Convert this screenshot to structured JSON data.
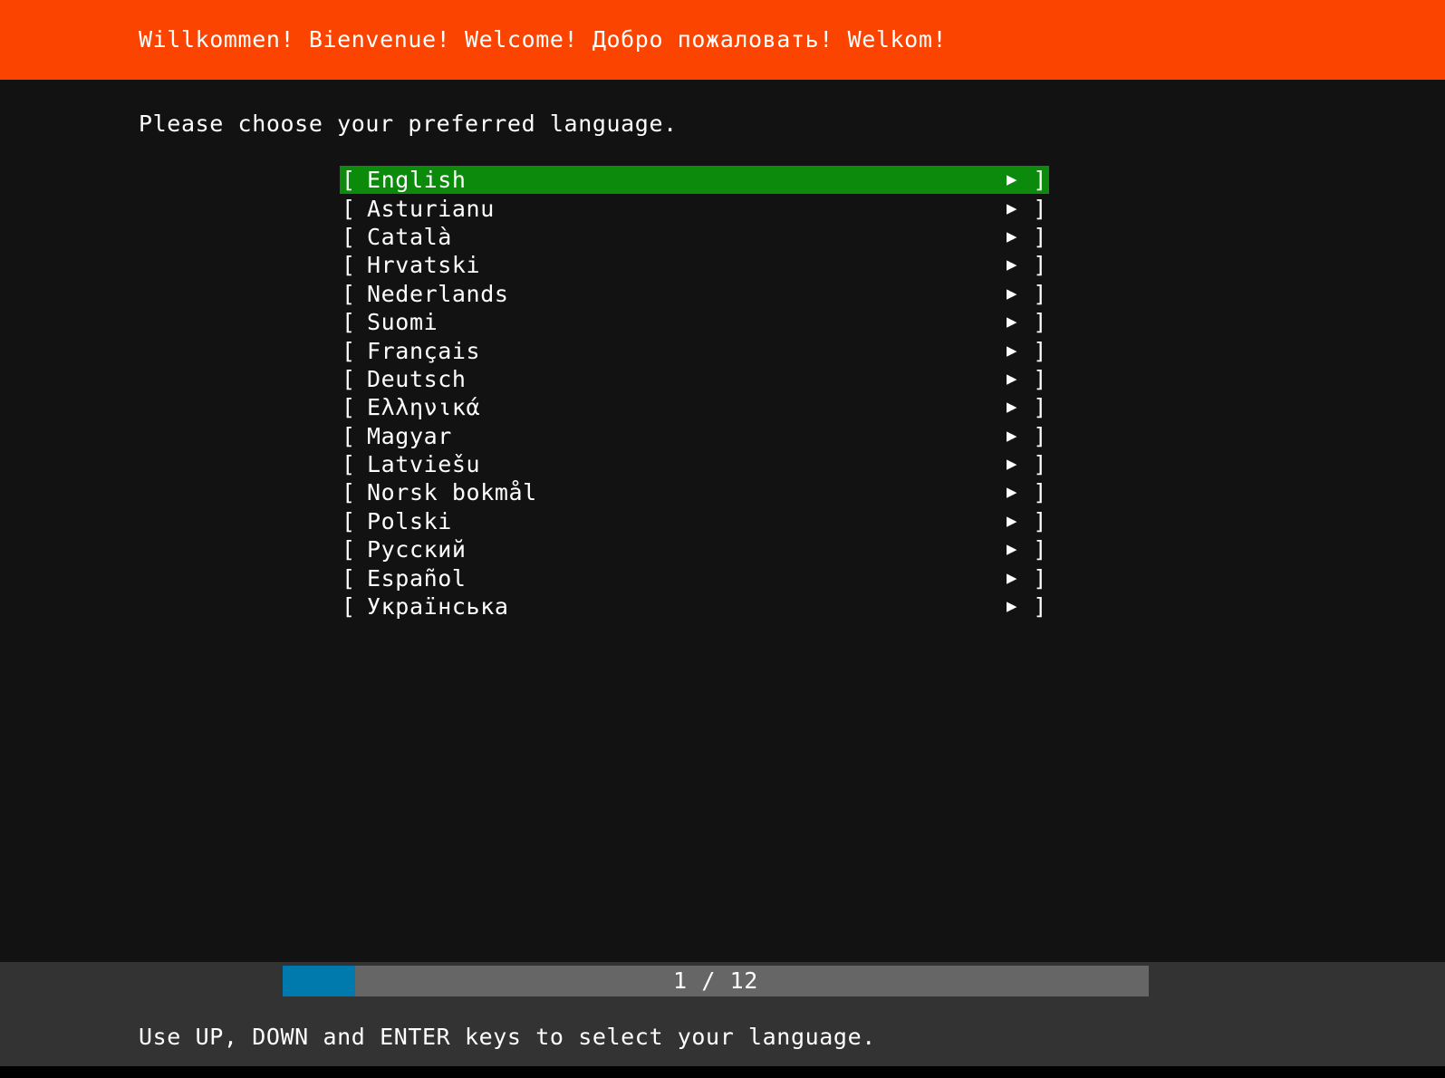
{
  "header": {
    "title": "Willkommen! Bienvenue! Welcome! Добро пожаловать! Welkom!",
    "background_color": "#fa4400",
    "text_color": "#ffffff"
  },
  "main": {
    "prompt": "Please choose your preferred language.",
    "background_color": "#121212",
    "selection_color": "#0b8a0b",
    "bracket_open": "[",
    "bracket_close": "]",
    "arrow_icon": "▶",
    "languages": [
      {
        "label": "English",
        "selected": true
      },
      {
        "label": "Asturianu",
        "selected": false
      },
      {
        "label": "Català",
        "selected": false
      },
      {
        "label": "Hrvatski",
        "selected": false
      },
      {
        "label": "Nederlands",
        "selected": false
      },
      {
        "label": "Suomi",
        "selected": false
      },
      {
        "label": "Français",
        "selected": false
      },
      {
        "label": "Deutsch",
        "selected": false
      },
      {
        "label": "Ελληνικά",
        "selected": false
      },
      {
        "label": "Magyar",
        "selected": false
      },
      {
        "label": "Latviešu",
        "selected": false
      },
      {
        "label": "Norsk bokmål",
        "selected": false
      },
      {
        "label": "Polski",
        "selected": false
      },
      {
        "label": "Русский",
        "selected": false
      },
      {
        "label": "Español",
        "selected": false
      },
      {
        "label": "Українська",
        "selected": false
      }
    ]
  },
  "footer": {
    "progress": {
      "current": 1,
      "total": 12,
      "text": "1 / 12",
      "percent": 8.4,
      "fill_color": "#0079ad",
      "track_color": "#666666"
    },
    "hint": "Use UP, DOWN and ENTER keys to select your language.",
    "background_color": "#333333"
  }
}
